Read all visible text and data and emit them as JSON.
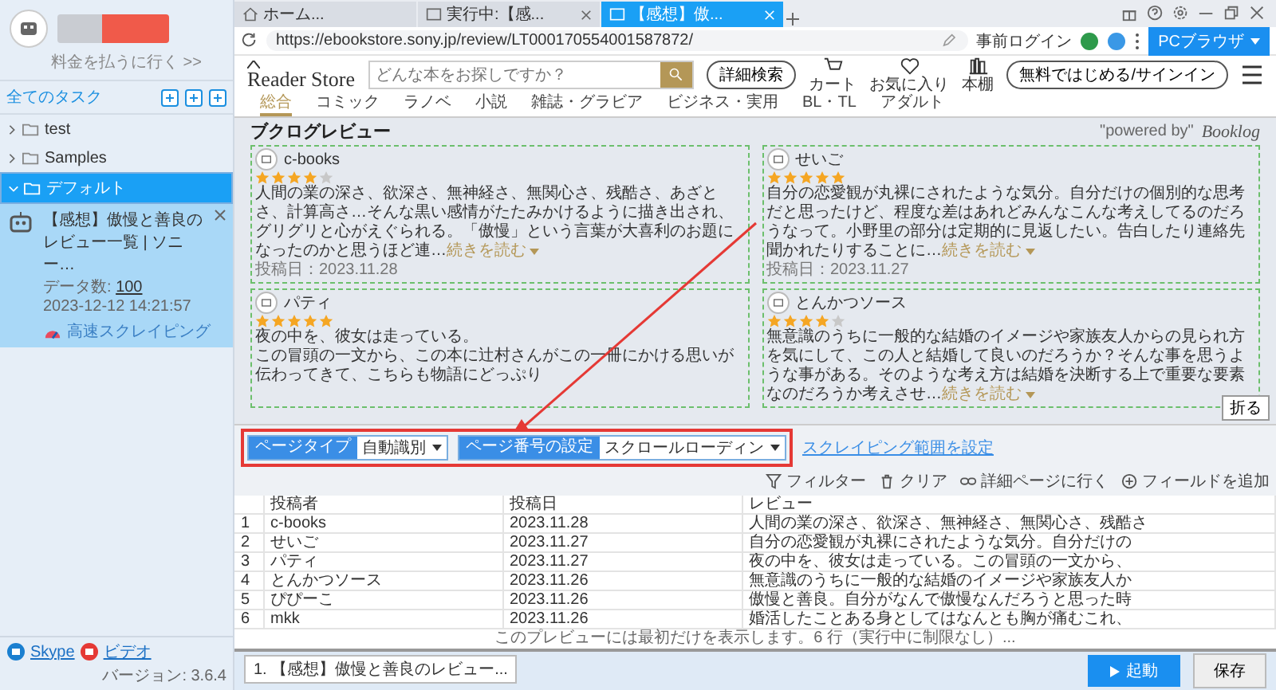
{
  "sidebar": {
    "pay_link": "料金を払うに行く >>",
    "all_tasks": "全てのタスク",
    "folders": [
      {
        "label": "test",
        "expanded": false,
        "selected": false
      },
      {
        "label": "Samples",
        "expanded": false,
        "selected": false
      },
      {
        "label": "デフォルト",
        "expanded": true,
        "selected": true,
        "tasks": [
          {
            "title": "【感想】傲慢と善良のレビュー一覧 | ソニー…",
            "count_label": "データ数:",
            "count": "100",
            "time": "2023-12-12 14:21:57",
            "mode": "高速スクレイピング"
          }
        ]
      }
    ],
    "footer_links": [
      "Skype",
      "ビデオ"
    ],
    "version": "バージョン: 3.6.4"
  },
  "browser": {
    "tabs": [
      {
        "label": "ホーム...",
        "kind": "home",
        "closable": false,
        "selected": false
      },
      {
        "label": "実行中:【感...",
        "kind": "page",
        "closable": true,
        "selected": false
      },
      {
        "label": "【感想】傲...",
        "kind": "page",
        "closable": true,
        "selected": true
      }
    ],
    "url": "https://ebookstore.sony.jp/review/LT000170554001587872/",
    "pre_login": "事前ログイン",
    "mode_button": "PCブラウザ"
  },
  "site": {
    "logo": "Reader Store",
    "search_placeholder": "どんな本をお探しですか？",
    "advanced_search": "詳細検索",
    "header_icons": [
      {
        "kind": "cart",
        "label": "カート"
      },
      {
        "kind": "heart",
        "label": "お気に入り"
      },
      {
        "kind": "shelf",
        "label": "本棚"
      }
    ],
    "signin": "無料ではじめる/サインイン",
    "nav": [
      {
        "label": "総合",
        "selected": true
      },
      {
        "label": "コミック",
        "selected": false
      },
      {
        "label": "ラノベ",
        "selected": false
      },
      {
        "label": "小説",
        "selected": false
      },
      {
        "label": "雑誌・グラビア",
        "selected": false
      },
      {
        "label": "ビジネス・実用",
        "selected": false
      },
      {
        "label": "BL・TL",
        "selected": false
      },
      {
        "label": "アダルト",
        "selected": false
      }
    ],
    "section_title": "ブクログレビュー",
    "powered_by": "\"powered by\"",
    "booklog": "Booklog",
    "reviews": [
      {
        "name": "c-books",
        "stars": 4,
        "paragraphs": [
          "人間の業の深さ、欲深さ、無神経さ、無関心さ、残酷さ、あざとさ、計算高さ…そんな黒い感情がたたみかけるように描き出され、グリグリと心がえぐられる。「傲慢」という言葉が大喜利のお題になったのかと思うほど連…"
        ],
        "more": "続きを読む",
        "date": "投稿日：2023.11.28"
      },
      {
        "name": "せいご",
        "stars": 5,
        "paragraphs": [
          "自分の恋愛観が丸裸にされたような気分。自分だけの個別的な思考だと思ったけど、程度な差はあれどみんなこんな考えしてるのだろうなって。小野里の部分は定期的に見返したい。告白したり連絡先聞かれたりすることに…"
        ],
        "more": "続きを読む",
        "date": "投稿日：2023.11.27"
      },
      {
        "name": "パティ",
        "stars": 5,
        "paragraphs": [
          "夜の中を、彼女は走っている。",
          "この冒頭の一文から、この本に辻村さんがこの一冊にかける思いが伝わってきて、こちらも物語にどっぷり"
        ]
      },
      {
        "name": "とんかつソース",
        "stars": 4,
        "paragraphs": [
          "無意識のうちに一般的な結婚のイメージや家族友人からの見られ方を気にして、この人と結婚して良いのだろうか？そんな事を思うような事がある。そのような考え方は結婚を決断する上で重要な要素なのだろうか考えさせ…"
        ],
        "more": "続きを読む"
      }
    ],
    "fold_button": "折る"
  },
  "toolbar": {
    "page_type": {
      "label": "ページタイプ",
      "value": "自動識別"
    },
    "page_number": {
      "label": "ページ番号の設定",
      "value": "スクロールローディン"
    },
    "range_link": "スクレイピング範囲を設定",
    "actions": [
      {
        "kind": "filter",
        "label": "フィルター"
      },
      {
        "kind": "clear",
        "label": "クリア"
      },
      {
        "kind": "link",
        "label": "詳細ページに行く"
      },
      {
        "kind": "add",
        "label": "フィールドを追加"
      }
    ]
  },
  "table": {
    "columns": [
      "投稿者",
      "投稿日",
      "レビュー"
    ],
    "rows": [
      {
        "index": "1",
        "cells": [
          "c-books",
          "2023.11.28",
          "人間の業の深さ、欲深さ、無神経さ、無関心さ、残酷さ"
        ]
      },
      {
        "index": "2",
        "cells": [
          "せいご",
          "2023.11.27",
          "自分の恋愛観が丸裸にされたような気分。自分だけの"
        ]
      },
      {
        "index": "3",
        "cells": [
          "パティ",
          "2023.11.27",
          "夜の中を、彼女は走っている。この冒頭の一文から、"
        ]
      },
      {
        "index": "4",
        "cells": [
          "とんかつソース",
          "2023.11.26",
          "無意識のうちに一般的な結婚のイメージや家族友人か"
        ]
      },
      {
        "index": "5",
        "cells": [
          "ぴぴーこ",
          "2023.11.26",
          "傲慢と善良。自分がなんで傲慢なんだろうと思った時"
        ]
      },
      {
        "index": "6",
        "cells": [
          "mkk",
          "2023.11.26",
          "婚活したことある身としてはなんとも胸が痛むこれ、"
        ]
      }
    ],
    "note": "このプレビューには最初だけを表示します。6 行（実行中に制限なし）..."
  },
  "bottom": {
    "task_tab": "1. 【感想】傲慢と善良のレビュー...",
    "start": "起動",
    "save": "保存"
  }
}
